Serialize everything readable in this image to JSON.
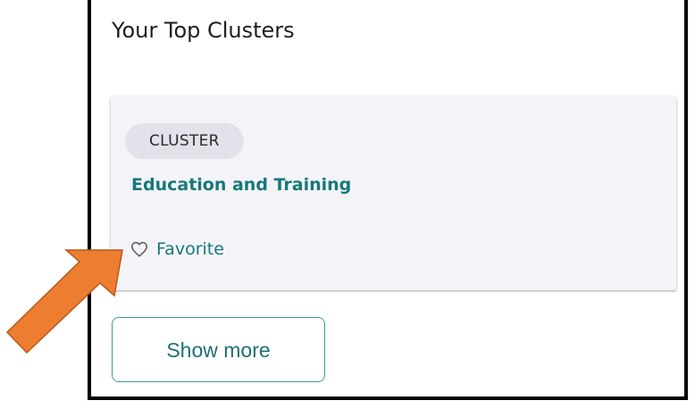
{
  "section": {
    "title": "Your Top Clusters"
  },
  "card": {
    "badge": "CLUSTER",
    "name": "Education and Training",
    "favorite_label": "Favorite",
    "favorite_icon": "heart-outline-icon"
  },
  "actions": {
    "show_more_label": "Show more"
  },
  "colors": {
    "accent_teal": "#16787a",
    "card_bg": "#f4f4f8",
    "badge_bg": "#e3e2eb",
    "annotation_arrow": "#ed7d31"
  }
}
